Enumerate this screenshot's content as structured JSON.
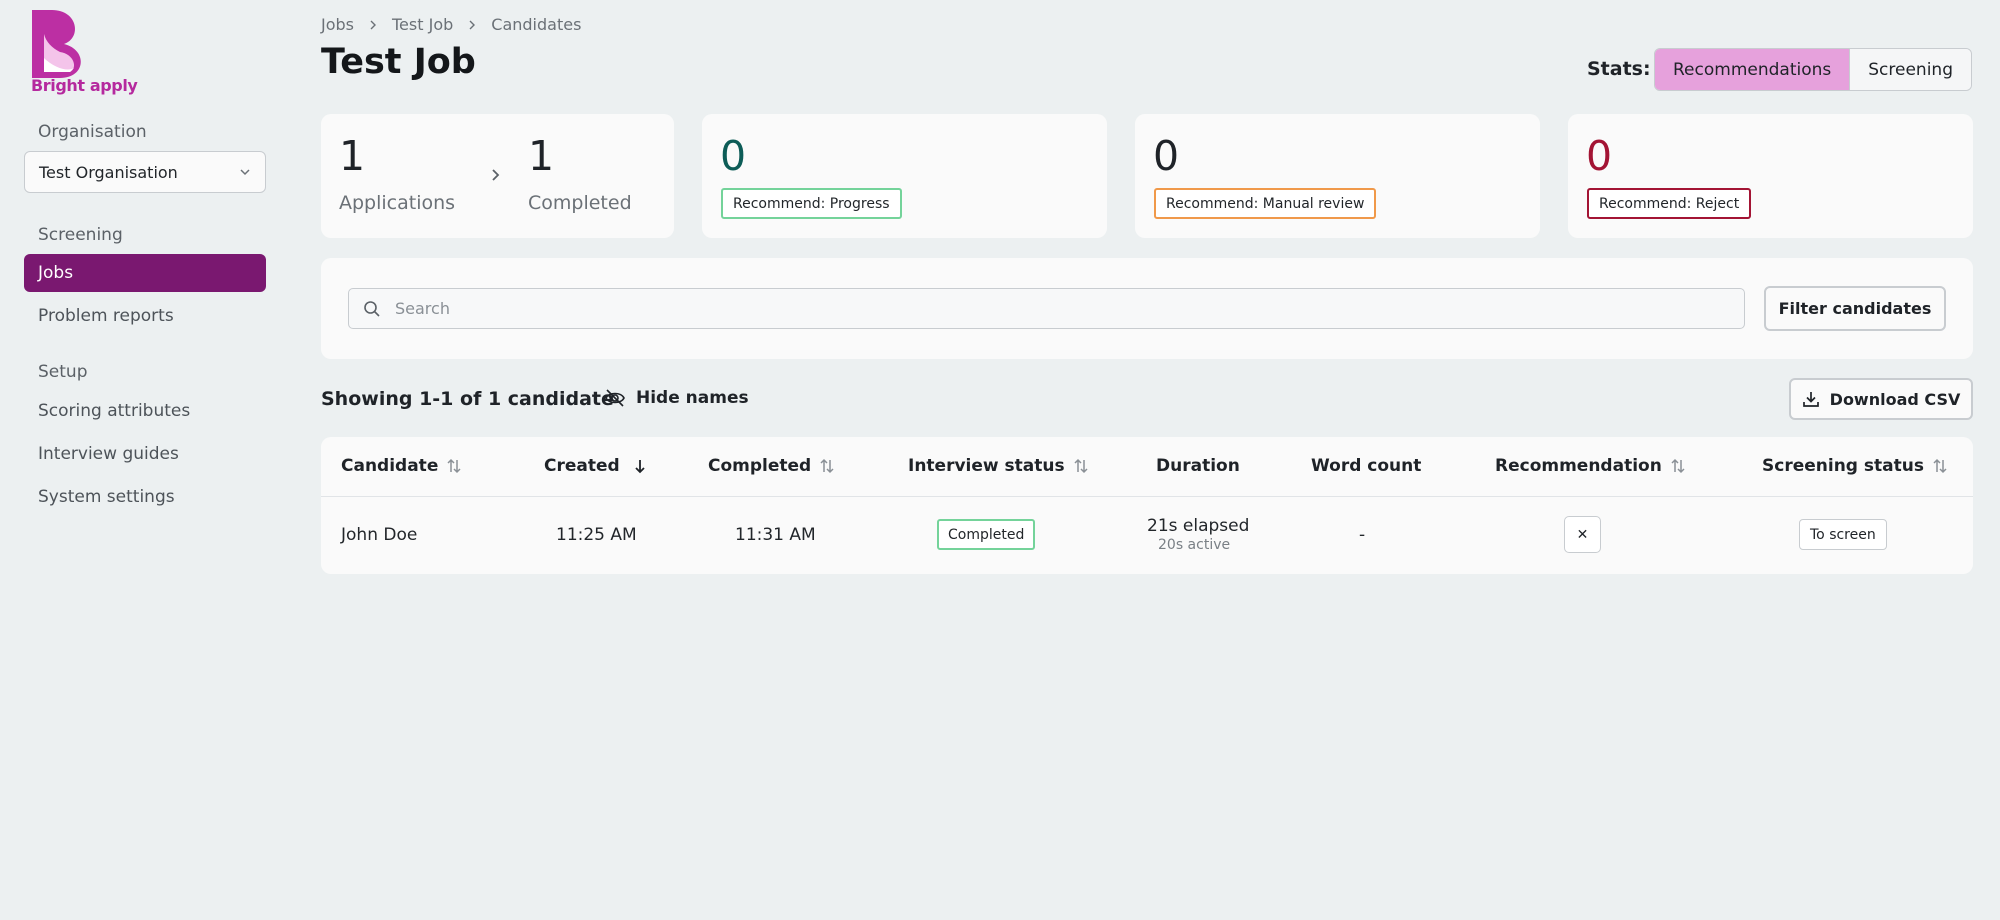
{
  "brand": {
    "name": "Bright apply",
    "color": "#b5299e"
  },
  "sidebar": {
    "organisation_heading": "Organisation",
    "organisation_value": "Test Organisation",
    "screening_heading": "Screening",
    "screening_items": [
      "Jobs",
      "Problem reports"
    ],
    "setup_heading": "Setup",
    "setup_items": [
      "Scoring attributes",
      "Interview guides",
      "System settings"
    ],
    "active_item": "Jobs"
  },
  "breadcrumb": [
    "Jobs",
    "Test Job",
    "Candidates"
  ],
  "page_title": "Test Job",
  "stats": {
    "label": "Stats:",
    "options": [
      "Recommendations",
      "Screening"
    ],
    "selected": "Recommendations"
  },
  "summary": {
    "applications_count": "1",
    "applications_label": "Applications",
    "completed_count": "1",
    "completed_label": "Completed"
  },
  "recommend_cards": [
    {
      "count": "0",
      "label": "Recommend: Progress",
      "color": "#0d5c57",
      "border": "#74d39a"
    },
    {
      "count": "0",
      "label": "Recommend: Manual review",
      "color": "#1f2328",
      "border": "#f0994a"
    },
    {
      "count": "0",
      "label": "Recommend: Reject",
      "color": "#a31434",
      "border": "#a31434"
    }
  ],
  "search": {
    "placeholder": "Search",
    "value": ""
  },
  "filter_button": "Filter candidates",
  "showing_text": "Showing 1-1 of 1 candidate",
  "hide_names_label": "Hide names",
  "download_button": "Download CSV",
  "table": {
    "columns": [
      "Candidate",
      "Created",
      "Completed",
      "Interview status",
      "Duration",
      "Word count",
      "Recommendation",
      "Screening status"
    ],
    "rows": [
      {
        "candidate": "John Doe",
        "created": "11:25 AM",
        "completed": "11:31 AM",
        "interview_status": "Completed",
        "duration_elapsed": "21s elapsed",
        "duration_active": "20s active",
        "word_count": "-",
        "recommendation": "✕",
        "screening_status": "To screen"
      }
    ]
  }
}
